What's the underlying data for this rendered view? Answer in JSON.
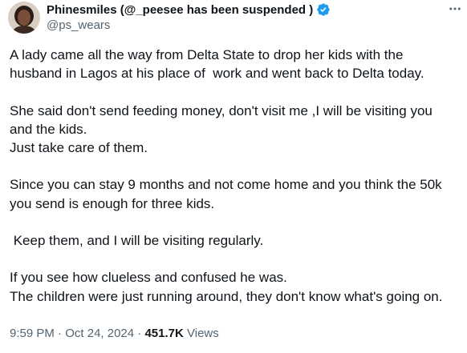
{
  "author": {
    "display_name": "Phinesmiles (@_peesee has been suspended )",
    "handle": "@ps_wears",
    "verified_icon": "verified-badge-icon",
    "verified_color": "#1d9bf0"
  },
  "tweet": {
    "paragraphs": [
      [
        "A lady came all the way from Delta State to drop her kids with the",
        "husband in Lagos at his place of  work and went back to Delta today."
      ],
      [
        "She said don't send feeding money, don't visit me ,I will be visiting you",
        "and the kids.",
        "Just take care of them."
      ],
      [
        "Since you can stay 9 months and not come home and you think the 50k",
        "you send is enough for three kids."
      ],
      [
        " Keep them, and I will be visiting regularly."
      ],
      [
        "If you see how clueless and confused he was.",
        "The children were just running around, they don't know what's going on."
      ]
    ]
  },
  "meta": {
    "time": "9:59 PM",
    "separator": "·",
    "date": "Oct 24, 2024",
    "views_count": "451.7K",
    "views_label": "Views"
  },
  "colors": {
    "text": "#0f1419",
    "secondary": "#536471",
    "accent": "#1d9bf0"
  }
}
